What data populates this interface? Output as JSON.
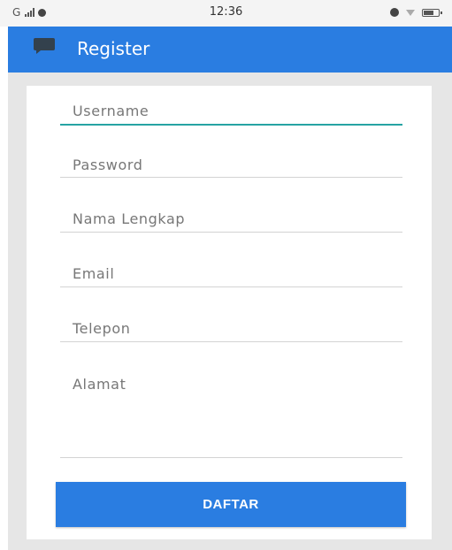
{
  "status_bar": {
    "carrier": "G",
    "time": "12:36",
    "icons": [
      "signal-icon",
      "notification-dot-icon",
      "alarm-icon",
      "wifi-icon",
      "battery-icon"
    ]
  },
  "app_bar": {
    "title": "Register",
    "icon": "chat-bubble-icon",
    "color": "#2a7de1"
  },
  "form": {
    "fields": [
      {
        "placeholder": "Username",
        "value": "",
        "focused": true
      },
      {
        "placeholder": "Password",
        "value": ""
      },
      {
        "placeholder": "Nama Lengkap",
        "value": ""
      },
      {
        "placeholder": "Email",
        "value": ""
      },
      {
        "placeholder": "Telepon",
        "value": ""
      },
      {
        "placeholder": "Alamat",
        "value": ""
      }
    ],
    "submit_label": "DAFTAR",
    "accent_color": "#26a3a3"
  }
}
